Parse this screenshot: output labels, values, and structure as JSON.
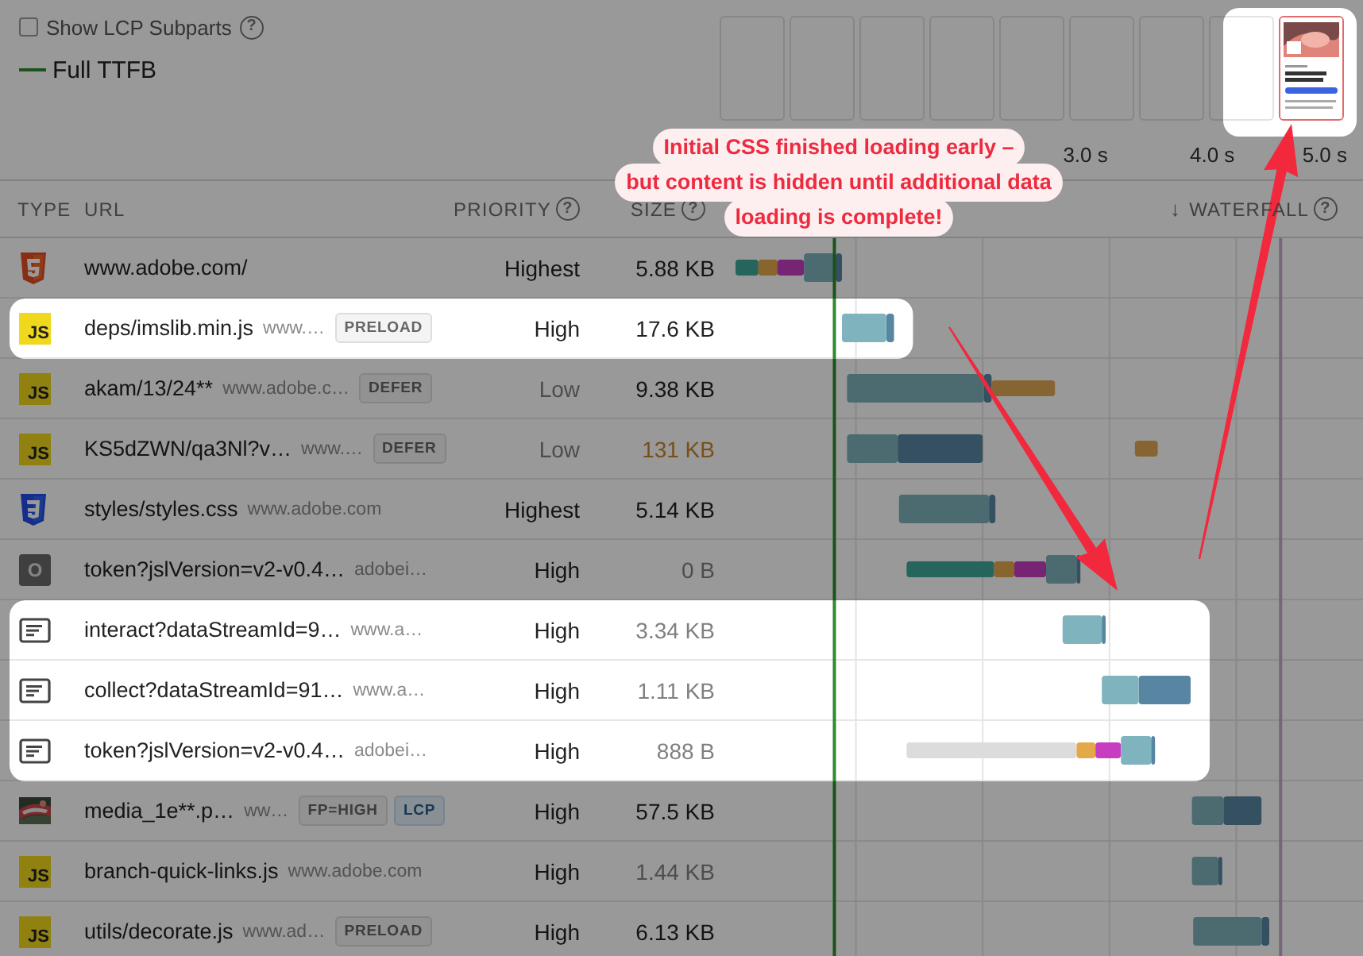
{
  "options": {
    "label": "Show LCP Subparts",
    "checked": false,
    "help": "?"
  },
  "legend": [
    {
      "label": "Full TTFB"
    }
  ],
  "filmstrip": [
    {
      "kind": "blank",
      "highlighted": false
    },
    {
      "kind": "blank",
      "highlighted": false
    },
    {
      "kind": "blank",
      "highlighted": false
    },
    {
      "kind": "blank",
      "highlighted": false
    },
    {
      "kind": "blank",
      "highlighted": false
    },
    {
      "kind": "blank",
      "highlighted": false
    },
    {
      "kind": "blank",
      "highlighted": false
    },
    {
      "kind": "blank",
      "highlighted": true
    },
    {
      "kind": "screenshot",
      "highlighted": true
    }
  ],
  "columns": [
    {
      "label": "TYPE"
    },
    {
      "label": "URL"
    },
    {
      "label": "PRIORITY",
      "help": "?"
    },
    {
      "label": "SIZE",
      "help": "?"
    },
    {
      "label": "WATERFALL",
      "sort": "↓",
      "help": "?"
    }
  ],
  "rows": [
    {
      "kind": "html",
      "name": "www.adobe.com/",
      "priority": "Highest",
      "priority_muted": false,
      "size": "5.88 KB",
      "size_muted": false,
      "size_warning": false,
      "highlighted": false
    },
    {
      "kind": "js",
      "icon_label": "JS",
      "name": "deps/imslib.min.js",
      "domain": "www.…",
      "badges": [
        {
          "label": "PRELOAD",
          "kind": "hint"
        }
      ],
      "priority": "High",
      "priority_muted": false,
      "size": "17.6 KB",
      "size_muted": false,
      "size_warning": false,
      "highlighted": true
    },
    {
      "kind": "js",
      "icon_label": "JS",
      "name": "akam/13/24**",
      "domain": "www.adobe.c…",
      "badges": [
        {
          "label": "DEFER",
          "kind": "hint"
        }
      ],
      "priority": "Low",
      "priority_muted": true,
      "size": "9.38 KB",
      "size_muted": false,
      "size_warning": false,
      "highlighted": false
    },
    {
      "kind": "js",
      "icon_label": "JS",
      "name": "KS5dZWN/qa3Nl?v…",
      "domain": "www.…",
      "badges": [
        {
          "label": "DEFER",
          "kind": "hint"
        }
      ],
      "priority": "Low",
      "priority_muted": true,
      "size": "131 KB",
      "size_muted": false,
      "size_warning": true,
      "highlighted": false
    },
    {
      "kind": "css",
      "name": "styles/styles.css",
      "domain": "www.adobe.com",
      "priority": "Highest",
      "priority_muted": false,
      "size": "5.14 KB",
      "size_muted": false,
      "size_warning": false,
      "highlighted": false
    },
    {
      "kind": "other",
      "icon_label": "O",
      "name": "token?jslVersion=v2-v0.4…",
      "domain": "adobei…",
      "priority": "High",
      "priority_muted": false,
      "size": "0 B",
      "size_muted": true,
      "size_warning": false,
      "highlighted": false
    },
    {
      "kind": "fetch",
      "name": "interact?dataStreamId=9…",
      "domain": "www.a…",
      "priority": "High",
      "priority_muted": false,
      "size": "3.34 KB",
      "size_muted": true,
      "size_warning": false,
      "highlighted": true
    },
    {
      "kind": "fetch",
      "name": "collect?dataStreamId=91…",
      "domain": "www.a…",
      "priority": "High",
      "priority_muted": false,
      "size": "1.11 KB",
      "size_muted": true,
      "size_warning": false,
      "highlighted": true
    },
    {
      "kind": "fetch",
      "name": "token?jslVersion=v2-v0.4…",
      "domain": "adobei…",
      "priority": "High",
      "priority_muted": false,
      "size": "888 B",
      "size_muted": true,
      "size_warning": false,
      "highlighted": true
    },
    {
      "name": "media_1e**.p…",
      "domain": "ww…",
      "badges": [
        {
          "label": "FP=HIGH",
          "kind": "hint"
        },
        {
          "label": "LCP",
          "kind": "lcp"
        }
      ],
      "priority": "High",
      "priority_muted": false,
      "size": "57.5 KB",
      "size_muted": false,
      "size_warning": false,
      "highlighted": false
    },
    {
      "kind": "js",
      "icon_label": "JS",
      "name": "branch-quick-links.js",
      "domain": "www.adobe.com",
      "priority": "High",
      "priority_muted": false,
      "size": "1.44 KB",
      "size_muted": true,
      "size_warning": false,
      "highlighted": false
    },
    {
      "kind": "js",
      "icon_label": "JS",
      "name": "utils/decorate.js",
      "domain": "www.ad…",
      "badges": [
        {
          "label": "PRELOAD",
          "kind": "hint"
        }
      ],
      "priority": "High",
      "priority_muted": false,
      "size": "6.13 KB",
      "size_muted": false,
      "size_warning": false,
      "highlighted": false
    }
  ],
  "timeline": {
    "ticks": [
      "3.0 s",
      "4.0 s",
      "5.0 s"
    ]
  },
  "callout": {
    "lines": [
      "Initial CSS finished loading early –",
      "but content is hidden until additional data",
      "loading is complete!"
    ],
    "arrows": true
  }
}
